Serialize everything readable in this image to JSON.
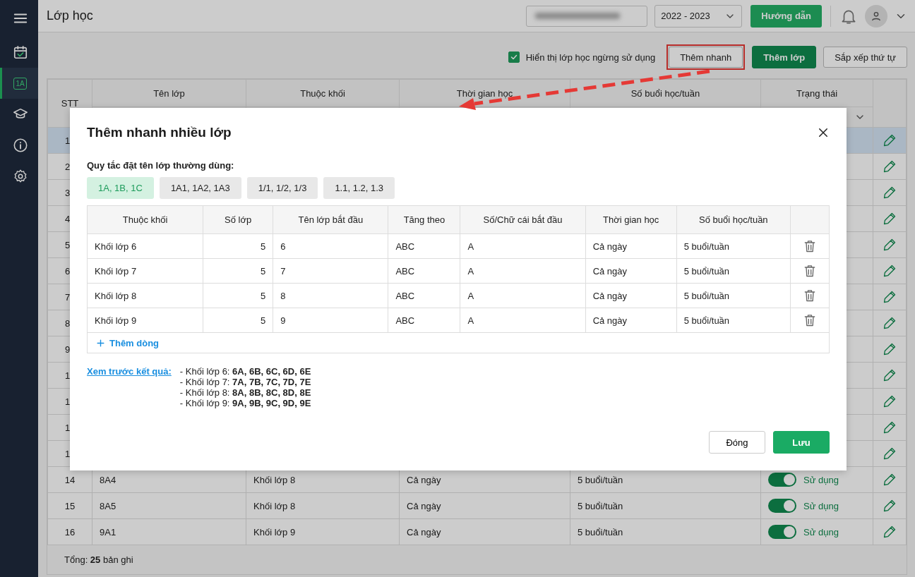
{
  "app": {
    "title": "Lớp học",
    "school_year": "2022 - 2023",
    "guide_button": "Hướng dẫn"
  },
  "sidebar": {
    "items": [
      {
        "kind": "calendar",
        "selected": false
      },
      {
        "kind": "class",
        "label": "1A",
        "selected": true
      },
      {
        "kind": "cap",
        "selected": false
      },
      {
        "kind": "info",
        "selected": false
      },
      {
        "kind": "settings",
        "selected": false
      }
    ]
  },
  "toolbar": {
    "show_inactive": {
      "label": "Hiển thị lớp học ngừng sử dụng",
      "checked": true
    },
    "buttons": [
      {
        "label": "Thêm nhanh",
        "kind": "outline",
        "highlighted": true
      },
      {
        "label": "Thêm lớp",
        "kind": "primary",
        "highlighted": false
      },
      {
        "label": "Sắp xếp thứ tự",
        "kind": "outline",
        "highlighted": false
      }
    ]
  },
  "table": {
    "columns": [
      "STT",
      "Tên lớp",
      "Thuộc khối",
      "Thời gian học",
      "Số buổi học/tuần",
      "Trạng thái"
    ],
    "rows": [
      {
        "stt": "1",
        "selected": true
      },
      {
        "stt": "2",
        "selected": false
      },
      {
        "stt": "3",
        "selected": false
      },
      {
        "stt": "4",
        "selected": false
      },
      {
        "stt": "5",
        "selected": false
      },
      {
        "stt": "6",
        "selected": false
      },
      {
        "stt": "7",
        "selected": false
      },
      {
        "stt": "8",
        "selected": false
      },
      {
        "stt": "9",
        "selected": false
      },
      {
        "stt": "1",
        "selected": false
      },
      {
        "stt": "1",
        "selected": false
      },
      {
        "stt": "1",
        "selected": false
      },
      {
        "stt": "1",
        "selected": false
      },
      {
        "stt": "14",
        "name": "8A4",
        "grade": "Khối lớp 8",
        "time": "Cả ngày",
        "sessions": "5 buổi/tuần",
        "active": true,
        "status": "Sử dụng",
        "selected": false
      },
      {
        "stt": "15",
        "name": "8A5",
        "grade": "Khối lớp 8",
        "time": "Cả ngày",
        "sessions": "5 buổi/tuần",
        "active": true,
        "status": "Sử dụng",
        "selected": false
      },
      {
        "stt": "16",
        "name": "9A1",
        "grade": "Khối lớp 9",
        "time": "Cả ngày",
        "sessions": "5 buổi/tuần",
        "active": true,
        "status": "Sử dụng",
        "selected": false
      }
    ],
    "total": "Tổng: **25** bản ghi"
  },
  "dialog": {
    "title": "Thêm nhanh nhiều lớp",
    "rule_label": "Quy tắc đặt tên lớp thường dùng:",
    "rules": [
      {
        "label": "1A, 1B, 1C",
        "selected": true
      },
      {
        "label": "1A1, 1A2, 1A3",
        "selected": false
      },
      {
        "label": "1/1, 1/2, 1/3",
        "selected": false
      },
      {
        "label": "1.1, 1.2, 1.3",
        "selected": false
      }
    ],
    "columns": [
      "Thuộc khối",
      "Số lớp",
      "Tên lớp bắt đầu",
      "Tăng theo",
      "Số/Chữ cái bắt đầu",
      "Thời gian học",
      "Số buổi học/tuần"
    ],
    "rows": [
      {
        "grade": "Khối lớp 6",
        "count": "5",
        "start": "6",
        "increment": "ABC",
        "start_char": "A",
        "time": "Cả ngày",
        "sessions": "5 buổi/tuần"
      },
      {
        "grade": "Khối lớp 7",
        "count": "5",
        "start": "7",
        "increment": "ABC",
        "start_char": "A",
        "time": "Cả ngày",
        "sessions": "5 buổi/tuần"
      },
      {
        "grade": "Khối lớp 8",
        "count": "5",
        "start": "8",
        "increment": "ABC",
        "start_char": "A",
        "time": "Cả ngày",
        "sessions": "5 buổi/tuần"
      },
      {
        "grade": "Khối lớp 9",
        "count": "5",
        "start": "9",
        "increment": "ABC",
        "start_char": "A",
        "time": "Cả ngày",
        "sessions": "5 buổi/tuần"
      }
    ],
    "add_row": "Thêm dòng",
    "preview_link": "Xem trước kết quả:",
    "preview": [
      "- Khối lớp 6: **6A, 6B, 6C, 6D, 6E**",
      "- Khối lớp 7: **7A, 7B, 7C, 7D, 7E**",
      "- Khối lớp 8: **8A, 8B, 8C, 8D, 8E**",
      "- Khối lớp 9: **9A, 9B, 9C, 9D, 9E**"
    ],
    "cancel_button": "Đóng",
    "save_button": "Lưu"
  }
}
